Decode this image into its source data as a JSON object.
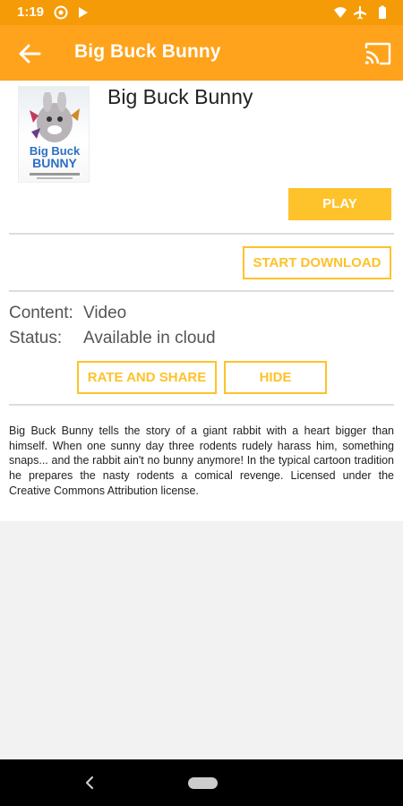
{
  "status_bar": {
    "time": "1:19"
  },
  "app_bar": {
    "title": "Big Buck Bunny"
  },
  "video": {
    "title": "Big Buck Bunny",
    "poster_title_line1": "Big Buck",
    "poster_title_line2": "BUNNY"
  },
  "actions": {
    "play_label": "PLAY",
    "download_label": "START DOWNLOAD",
    "rate_label": "RATE AND SHARE",
    "hide_label": "HIDE"
  },
  "info": {
    "content_label": "Content:",
    "content_value": "Video",
    "status_label": "Status:",
    "status_value": "Available in cloud"
  },
  "description": "Big Buck Bunny tells the story of a giant rabbit with a heart bigger than himself. When one sunny day three rodents rudely harass him, something snaps... and the rabbit ain't no bunny anymore! In the typical cartoon tradition he prepares the nasty rodents a comical revenge. Licensed under the Creative Commons Attribution license.",
  "colors": {
    "status_bar": "#f59b07",
    "app_bar": "#fea31b",
    "accent": "#fec22a"
  }
}
